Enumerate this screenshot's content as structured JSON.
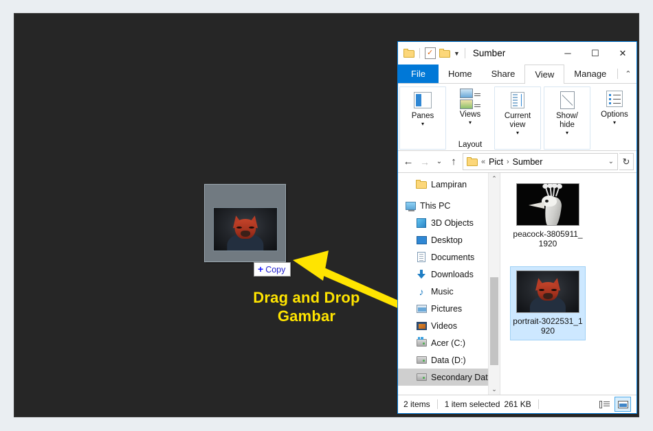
{
  "slide": {
    "caption_line1": "Drag and Drop",
    "caption_line2": "Gambar",
    "caption_color": "#ffe400",
    "arrow_color": "#ffe400",
    "background": "#262626"
  },
  "drag_ghost": {
    "copy_plus": "+",
    "copy_label": "Copy",
    "image_name": "portrait-3022531_1920"
  },
  "window": {
    "title": "Sumber",
    "accent_color": "#0078d7",
    "quick_access": [
      {
        "name": "folder-icon",
        "label": ""
      },
      {
        "name": "properties-icon",
        "label": ""
      },
      {
        "name": "new-folder-icon",
        "label": ""
      },
      {
        "name": "customize-dropdown-icon",
        "label": "▼"
      }
    ],
    "controls": {
      "minimize": "─",
      "maximize": "☐",
      "close": "✕"
    },
    "tabs": [
      {
        "label": "File",
        "state": "file"
      },
      {
        "label": "Home",
        "state": "normal"
      },
      {
        "label": "Share",
        "state": "normal"
      },
      {
        "label": "View",
        "state": "active"
      },
      {
        "label": "Manage",
        "state": "normal"
      }
    ],
    "tab_right": {
      "collapse": "⌃",
      "help": "?"
    },
    "ribbon": {
      "groups": [
        {
          "group_label": "",
          "items": [
            {
              "label": "Panes",
              "caret": "▾",
              "icon": "panes-icon"
            }
          ]
        },
        {
          "group_label": "Layout",
          "items": [
            {
              "label": "Views",
              "caret": "▾",
              "icon": "views-icon"
            }
          ]
        },
        {
          "group_label": "",
          "items": [
            {
              "label": "Current view",
              "caret": "▾",
              "icon": "current-view-icon"
            }
          ]
        },
        {
          "group_label": "",
          "items": [
            {
              "label": "Show/ hide",
              "caret": "▾",
              "icon": "show-hide-icon"
            }
          ]
        },
        {
          "group_label": "",
          "items": [
            {
              "label": "Options",
              "caret": "▾",
              "icon": "options-icon"
            }
          ]
        }
      ]
    },
    "address_bar": {
      "back": "←",
      "forward": "→",
      "recent": "⌄",
      "up": "↑",
      "crumbs": [
        "«",
        "Pict",
        "›",
        "Sumber"
      ],
      "dropdown": "⌄",
      "refresh": "↻"
    },
    "nav_pane": {
      "items": [
        {
          "label": "Lampiran",
          "icon": "folder-icon",
          "indent": true,
          "selected": false
        },
        {
          "label": "This PC",
          "icon": "this-pc-icon",
          "indent": false,
          "selected": false
        },
        {
          "label": "3D Objects",
          "icon": "3d-objects-icon",
          "indent": true,
          "selected": false
        },
        {
          "label": "Desktop",
          "icon": "desktop-icon",
          "indent": true,
          "selected": false
        },
        {
          "label": "Documents",
          "icon": "documents-icon",
          "indent": true,
          "selected": false
        },
        {
          "label": "Downloads",
          "icon": "downloads-icon",
          "indent": true,
          "selected": false
        },
        {
          "label": "Music",
          "icon": "music-icon",
          "indent": true,
          "selected": false
        },
        {
          "label": "Pictures",
          "icon": "pictures-icon",
          "indent": true,
          "selected": false
        },
        {
          "label": "Videos",
          "icon": "videos-icon",
          "indent": true,
          "selected": false
        },
        {
          "label": "Acer (C:)",
          "icon": "drive-icon",
          "indent": true,
          "selected": false
        },
        {
          "label": "Data  (D:)",
          "icon": "drive-icon",
          "indent": true,
          "selected": false
        },
        {
          "label": "Secondary Data",
          "icon": "drive-icon",
          "indent": true,
          "selected": true
        }
      ],
      "scroll_up": "⌃",
      "scroll_down": "⌄"
    },
    "files": [
      {
        "name": "peacock-3805911_1920",
        "art": "peacock",
        "selected": false
      },
      {
        "name": "portrait-3022531_1920",
        "art": "portrait",
        "selected": true
      }
    ],
    "status_bar": {
      "item_count": "2 items",
      "selection": "1 item selected",
      "size": "261 KB",
      "view_details": "details-view-icon",
      "view_large": "large-icons-view-icon"
    }
  }
}
